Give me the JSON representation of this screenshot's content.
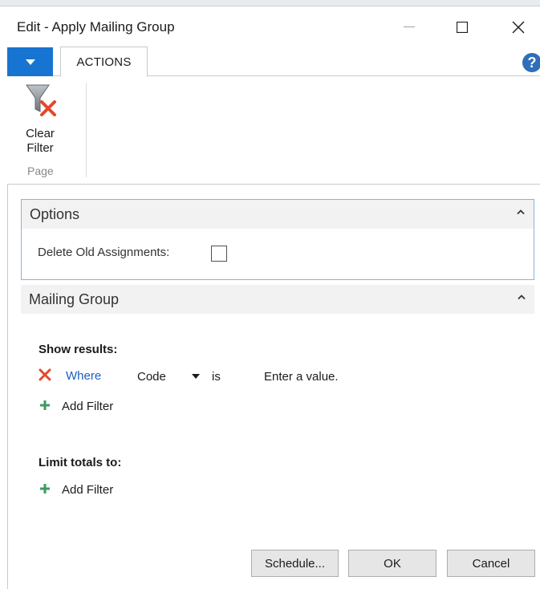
{
  "window": {
    "title": "Edit - Apply Mailing Group"
  },
  "ribbon": {
    "tab_label": "ACTIONS",
    "clear_filter_label": "Clear Filter",
    "group_label": "Page"
  },
  "options": {
    "title": "Options",
    "delete_old_label": "Delete Old Assignments:",
    "delete_old_checked": false
  },
  "mailing_group": {
    "title": "Mailing Group"
  },
  "filters": {
    "show_results_label": "Show results:",
    "where_label": "Where",
    "field": "Code",
    "operator": "is",
    "value_placeholder": "Enter a value.",
    "add_filter_label": "Add Filter",
    "limit_totals_label": "Limit totals to:",
    "add_filter_label_2": "Add Filter"
  },
  "buttons": {
    "schedule": "Schedule...",
    "ok": "OK",
    "cancel": "Cancel"
  },
  "icons": {
    "clear_filter": "funnel-x-icon",
    "remove_filter": "x-icon",
    "add_filter": "plus-icon",
    "help": "question-icon"
  },
  "colors": {
    "accent_blue": "#1774d1",
    "link_blue": "#1b5fc1",
    "remove_red": "#e2492b",
    "add_green": "#3c9b5f",
    "section_border": "#89b3e0"
  }
}
